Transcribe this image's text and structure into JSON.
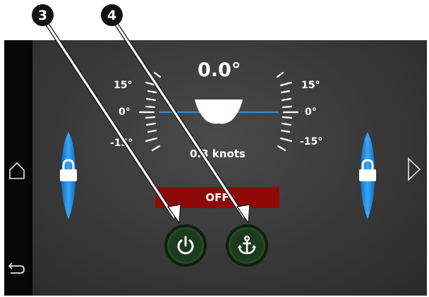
{
  "callouts": [
    {
      "number": "3"
    },
    {
      "number": "4"
    }
  ],
  "gauge": {
    "heading": "0.0°",
    "left_scale": {
      "top": "15°",
      "mid": "0°",
      "bottom": "-15°"
    },
    "right_scale": {
      "top": "15°",
      "mid": "0°",
      "bottom": "-15°"
    }
  },
  "speed": {
    "text": "0.3 knots"
  },
  "status": {
    "label": "OFF"
  },
  "buttons": {
    "power_icon": "power-icon",
    "anchor_icon": "anchor-icon"
  },
  "nav": {
    "home_icon": "home-icon",
    "back_icon": "back-icon",
    "next_icon": "chevron-right-icon"
  },
  "colors": {
    "status_off": "#8e0a0a",
    "trim_blue": "#1e8ee8",
    "button_ring": "#1c3a1c",
    "waterline": "#3a8fd0"
  }
}
